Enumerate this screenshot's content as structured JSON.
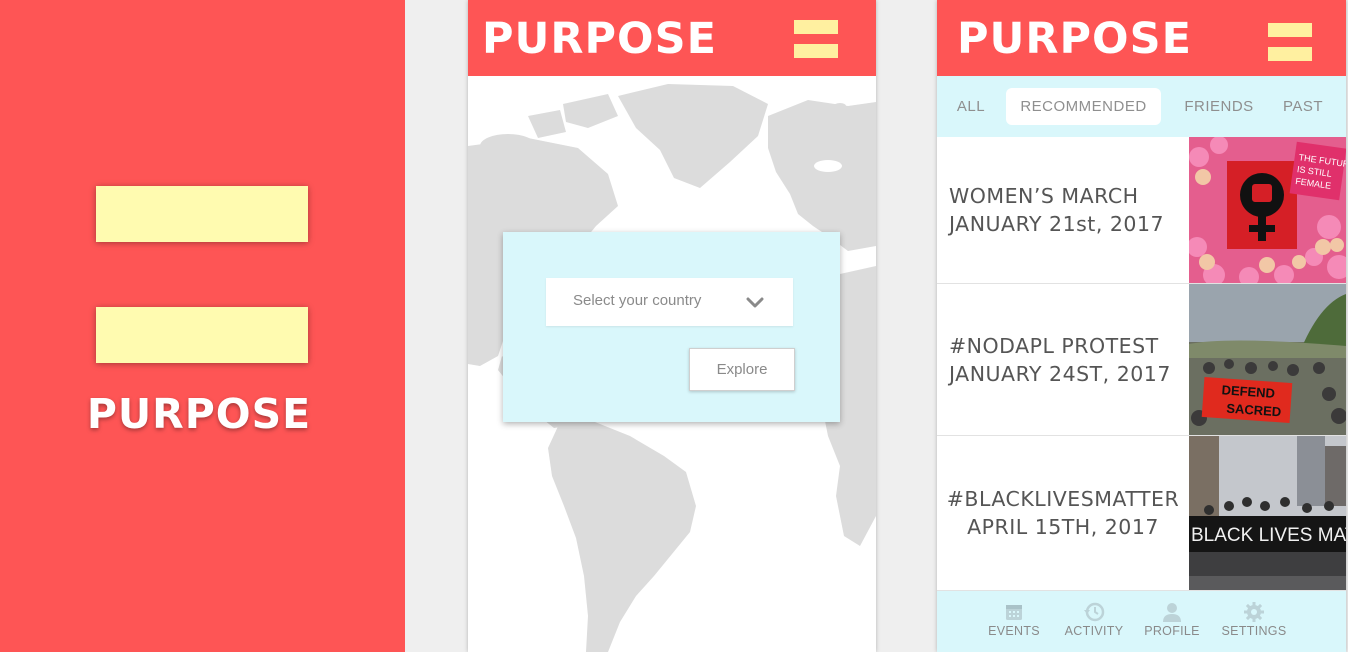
{
  "splash": {
    "title": "PURPOSE"
  },
  "map_screen": {
    "title": "PURPOSE",
    "country_select": {
      "placeholder": "Select your country"
    },
    "explore_label": "Explore"
  },
  "events_screen": {
    "title": "PURPOSE",
    "tabs": [
      {
        "label": "ALL",
        "active": false
      },
      {
        "label": "RECOMMENDED",
        "active": true
      },
      {
        "label": "FRIENDS",
        "active": false
      },
      {
        "label": "PAST",
        "active": false
      }
    ],
    "events": [
      {
        "name": "WOMEN’S MARCH",
        "date": "JANUARY 21st, 2017",
        "photo_banner": "THE FUTURE IS STILL FEMALE"
      },
      {
        "name": "#NODAPL PROTEST",
        "date": "JANUARY 24ST, 2017",
        "photo_banner": "DEFEND THE SACRED"
      },
      {
        "name": "#BLACKLIVESMATTER",
        "date": "APRIL 15TH, 2017",
        "photo_banner": "BLACK LIVES MAT"
      }
    ],
    "bottom_nav": [
      {
        "label": "EVENTS",
        "icon": "calendar-icon"
      },
      {
        "label": "ACTIVITY",
        "icon": "history-icon"
      },
      {
        "label": "PROFILE",
        "icon": "user-icon"
      },
      {
        "label": "SETTINGS",
        "icon": "gear-icon"
      }
    ]
  },
  "colors": {
    "brand_red": "#fe5555",
    "menu_yellow": "#fffbb0",
    "panel_cyan": "#d9f7fb",
    "map_land": "#dcdcdc",
    "text_gray": "#8a8a8a"
  }
}
